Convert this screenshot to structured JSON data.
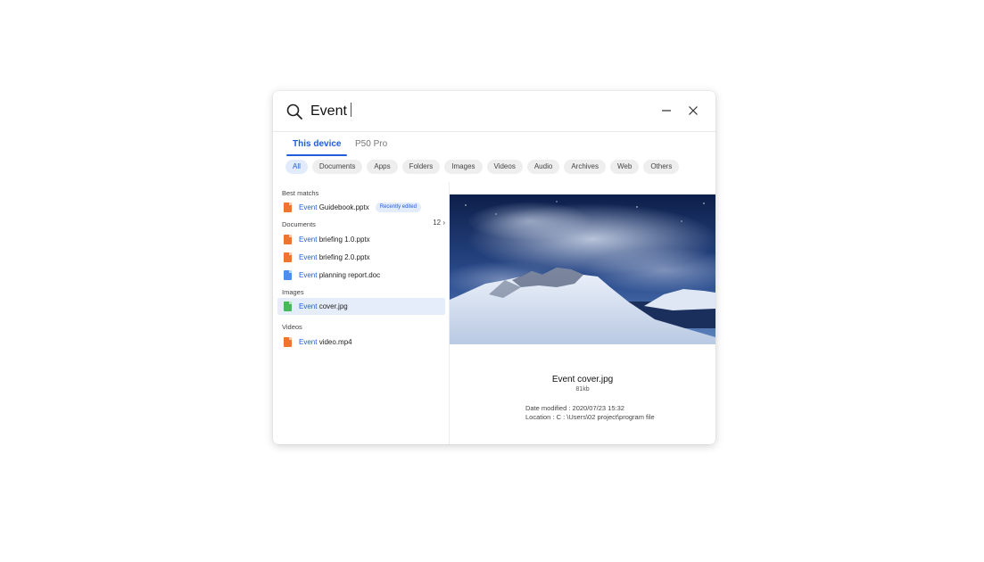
{
  "search": {
    "query": "Event"
  },
  "tabs": [
    {
      "label": "This device"
    },
    {
      "label": "P50 Pro"
    }
  ],
  "filters": [
    "All",
    "Documents",
    "Apps",
    "Folders",
    "Images",
    "Videos",
    "Audio",
    "Archives",
    "Web",
    "Others"
  ],
  "results": {
    "best_matches": {
      "title": "Best matchs",
      "items": [
        {
          "highlight": "Event",
          "rest": " Guidebook.pptx",
          "badge": "Recently edited",
          "icon": "pptx-icon"
        }
      ]
    },
    "documents": {
      "title": "Documents",
      "count": "12",
      "items": [
        {
          "highlight": "Event",
          "rest": " briefing 1.0.pptx",
          "icon": "pptx-icon"
        },
        {
          "highlight": "Event",
          "rest": " briefing 2.0.pptx",
          "icon": "pptx-icon"
        },
        {
          "highlight": "Event",
          "rest": " planning report.doc",
          "icon": "doc-icon"
        }
      ]
    },
    "images": {
      "title": "Images",
      "items": [
        {
          "highlight": "Event",
          "rest": " cover.jpg",
          "icon": "image-icon"
        }
      ]
    },
    "videos": {
      "title": "Videos",
      "items": [
        {
          "highlight": "Event",
          "rest": " video.mp4",
          "icon": "video-icon"
        }
      ]
    }
  },
  "preview": {
    "name": "Event cover.jpg",
    "size": "81kb",
    "date_modified": "Date modified   : 2020/07/23 15:32",
    "location": "Location : C : \\Users\\02 project\\program file"
  },
  "colors": {
    "accent": "#1f5ed8",
    "selected_row": "#e5edfa",
    "pptx": "#f0732e",
    "doc": "#4a8ef0",
    "image": "#49b85b"
  }
}
